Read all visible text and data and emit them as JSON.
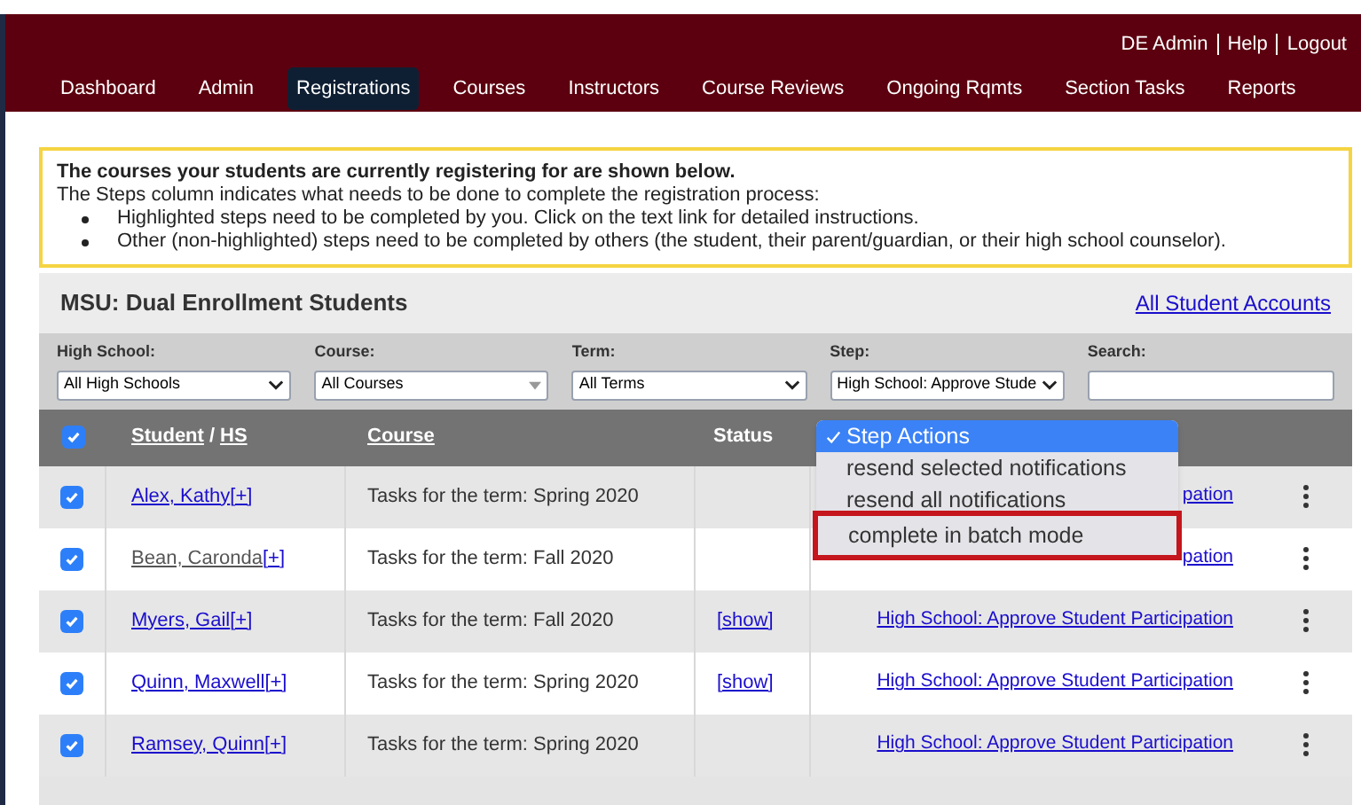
{
  "top_links": [
    "DE Admin",
    "Help",
    "Logout"
  ],
  "nav": [
    {
      "label": "Dashboard",
      "selected": false
    },
    {
      "label": "Admin",
      "selected": false
    },
    {
      "label": "Registrations",
      "selected": true
    },
    {
      "label": "Courses",
      "selected": false
    },
    {
      "label": "Instructors",
      "selected": false
    },
    {
      "label": "Course Reviews",
      "selected": false
    },
    {
      "label": "Ongoing Rqmts",
      "selected": false
    },
    {
      "label": "Section Tasks",
      "selected": false
    },
    {
      "label": "Reports",
      "selected": false
    }
  ],
  "notice": {
    "title": "The courses your students are currently registering for are shown below.",
    "intro": "The Steps column indicates what needs to be done to complete the registration process:",
    "bullets": [
      "Highlighted steps need to be completed by you. Click on the text link for detailed instructions.",
      "Other (non-highlighted) steps need to be completed by others (the student, their parent/guardian, or their high school counselor)."
    ]
  },
  "panel": {
    "title": "MSU: Dual Enrollment Students",
    "link": "All Student Accounts"
  },
  "filters": [
    {
      "label": "High School:",
      "kind": "select",
      "value": "All High Schools"
    },
    {
      "label": "Course:",
      "kind": "combo",
      "value": "All Courses"
    },
    {
      "label": "Term:",
      "kind": "select",
      "value": "All Terms"
    },
    {
      "label": "Step:",
      "kind": "select",
      "value": "High School: Approve Stude"
    },
    {
      "label": "Search:",
      "kind": "text"
    }
  ],
  "table": {
    "all_checked": true,
    "columns": {
      "student": "Student",
      "separator": "/",
      "hs": "HS",
      "course": "Course",
      "status": "Status"
    },
    "rows": [
      {
        "checked": true,
        "student": "Alex, Kathy",
        "plus": "[+]",
        "course": "Tasks for the term: Spring 2020",
        "status": "",
        "step": "pation"
      },
      {
        "checked": true,
        "student": "Bean, Caronda",
        "plus": "[+]",
        "course": "Tasks for the term: Fall 2020",
        "status": "",
        "step": "pation"
      },
      {
        "checked": true,
        "student": "Myers, Gail",
        "plus": "[+]",
        "course": "Tasks for the term: Fall 2020",
        "status": "[show]",
        "step": "High School: Approve Student Participation"
      },
      {
        "checked": true,
        "student": "Quinn, Maxwell",
        "plus": "[+]",
        "course": "Tasks for the term: Spring 2020",
        "status": "[show]",
        "step": "High School: Approve Student Participation"
      },
      {
        "checked": true,
        "student": "Ramsey, Quinn",
        "plus": "[+]",
        "course": "Tasks for the term: Spring 2020",
        "status": "",
        "step": "High School: Approve Student Participation"
      }
    ]
  },
  "step_actions_menu": [
    {
      "label": "Step Actions",
      "selected": true,
      "highlighted": false
    },
    {
      "label": "resend selected notifications",
      "selected": false,
      "highlighted": false
    },
    {
      "label": "resend all notifications",
      "selected": false,
      "highlighted": false
    },
    {
      "label": "complete in batch mode",
      "selected": false,
      "highlighted": true
    }
  ]
}
